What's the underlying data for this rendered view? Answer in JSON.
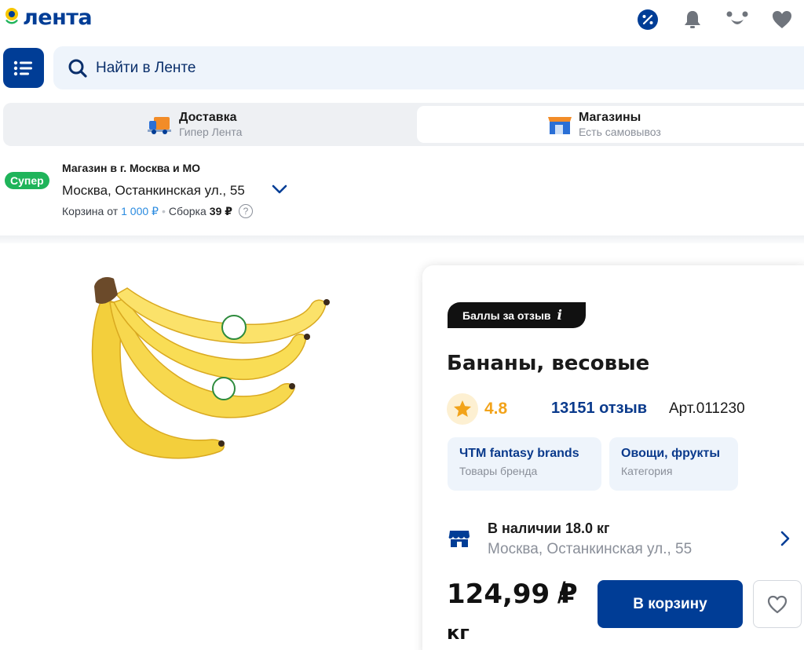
{
  "header": {
    "logo_text": "лента",
    "icons": [
      "percent-icon",
      "bell-icon",
      "smiley-icon",
      "heart-icon"
    ]
  },
  "search": {
    "placeholder": "Найти в Ленте"
  },
  "mode_switch": {
    "delivery": {
      "title": "Доставка",
      "subtitle": "Гипер Лента"
    },
    "stores": {
      "title": "Магазины",
      "subtitle": "Есть самовывоз"
    }
  },
  "store": {
    "badge": "Супер",
    "kind": "Магазин в г. Москва и МО",
    "address": "Москва, Останкинская ул., 55",
    "cart_from_label": "Корзина от",
    "cart_from_value": "1 000 ₽",
    "dot": "•",
    "assembly_label": "Сборка",
    "assembly_value": "39 ₽",
    "help": "?"
  },
  "product": {
    "review_badge": "Баллы за отзыв",
    "review_badge_icon": "i",
    "title": "Бананы, весовые",
    "rating": "4.8",
    "reviews": "13151 отзыв",
    "article": "Арт.011230",
    "brand_tag": {
      "title": "ЧТМ fantasy brands",
      "subtitle": "Товары бренда"
    },
    "category_tag": {
      "title": "Овощи, фрукты",
      "subtitle": "Категория"
    },
    "stock_title": "В наличии 18.0 кг",
    "stock_address": "Москва, Останкинская ул., 55",
    "price": "124,99 ₽",
    "price_slash": "/",
    "price_unit": "кг",
    "cart_button": "В корзину"
  },
  "colors": {
    "brand_blue": "#003d96",
    "link_blue": "#0a3a8c",
    "super_green": "#1fb45a",
    "rating_orange": "#f2a31a"
  }
}
